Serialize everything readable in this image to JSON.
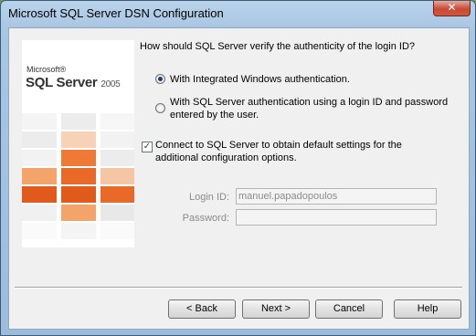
{
  "window": {
    "title": "Microsoft SQL Server DSN Configuration",
    "close_glyph": "✕"
  },
  "logo": {
    "ms": "Microsoft®",
    "product": "SQL Server",
    "year": "2005"
  },
  "question": "How should SQL Server verify the authenticity of the login ID?",
  "auth_options": [
    {
      "label": "With Integrated Windows authentication.",
      "selected": true
    },
    {
      "label_line1": "With SQL Server authentication using a login ID and password",
      "label_line2": "entered by the user.",
      "selected": false
    }
  ],
  "connect_default": {
    "line1": "Connect to SQL Server to obtain default settings for the",
    "line2": "additional configuration options.",
    "checked": true,
    "check_glyph": "✓"
  },
  "login": {
    "label": "Login ID:",
    "value": "manuel.papadopoulos"
  },
  "password": {
    "label": "Password:",
    "value": ""
  },
  "buttons": {
    "back": "< Back",
    "next": "Next >",
    "cancel": "Cancel",
    "help": "Help"
  },
  "colors": {
    "orange_dark": "#e05a1c",
    "orange_mid": "#ee7a36",
    "orange_light": "#f3a46a",
    "titlebar": "#a9c6e3"
  }
}
